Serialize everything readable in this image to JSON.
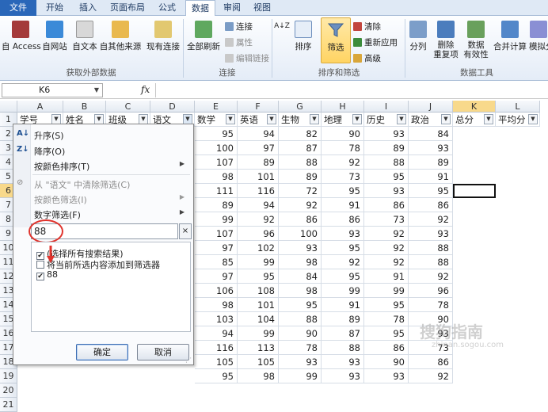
{
  "ribbon_tabs": [
    "文件",
    "开始",
    "插入",
    "页面布局",
    "公式",
    "数据",
    "审阅",
    "视图"
  ],
  "ribbon": {
    "external": {
      "access": "自 Access",
      "web": "自网站",
      "text": "自文本",
      "other": "自其他来源",
      "existing": "现有连接",
      "group": "获取外部数据"
    },
    "connections": {
      "refresh_all": "全部刷新",
      "connections": "连接",
      "properties": "属性",
      "edit_links": "编辑链接",
      "group": "连接"
    },
    "sort_filter": {
      "sort": "排序",
      "filter": "筛选",
      "clear": "清除",
      "reapply": "重新应用",
      "advanced": "高级",
      "group": "排序和筛选"
    },
    "data_tools": {
      "text_to_columns": "分列",
      "remove_dup_1": "删除",
      "remove_dup_2": "重复项",
      "validation_1": "数据",
      "validation_2": "有效性",
      "consolidate": "合并计算",
      "whatif": "模拟分",
      "group": "数据工具"
    }
  },
  "formula_bar": {
    "name_box": "K6",
    "fx": "fx",
    "formula": ""
  },
  "columns": [
    "A",
    "B",
    "C",
    "D",
    "E",
    "F",
    "G",
    "H",
    "I",
    "J",
    "K",
    "L"
  ],
  "headers": [
    "学号",
    "姓名",
    "班级",
    "语文",
    "数学",
    "英语",
    "生物",
    "地理",
    "历史",
    "政治",
    "总分",
    "平均分"
  ],
  "rows": [
    [
      "95",
      "94",
      "82",
      "90",
      "93",
      "84"
    ],
    [
      "100",
      "97",
      "87",
      "78",
      "89",
      "93"
    ],
    [
      "107",
      "89",
      "88",
      "92",
      "88",
      "89"
    ],
    [
      "98",
      "101",
      "89",
      "73",
      "95",
      "91"
    ],
    [
      "111",
      "116",
      "72",
      "95",
      "93",
      "95"
    ],
    [
      "89",
      "94",
      "92",
      "91",
      "86",
      "86"
    ],
    [
      "99",
      "92",
      "86",
      "86",
      "73",
      "92"
    ],
    [
      "107",
      "96",
      "100",
      "93",
      "92",
      "93"
    ],
    [
      "97",
      "102",
      "93",
      "95",
      "92",
      "88"
    ],
    [
      "85",
      "99",
      "98",
      "92",
      "92",
      "88"
    ],
    [
      "97",
      "95",
      "84",
      "95",
      "91",
      "92"
    ],
    [
      "106",
      "108",
      "98",
      "99",
      "99",
      "96"
    ],
    [
      "98",
      "101",
      "95",
      "91",
      "95",
      "78"
    ],
    [
      "103",
      "104",
      "88",
      "89",
      "78",
      "90"
    ],
    [
      "94",
      "99",
      "90",
      "87",
      "95",
      "93"
    ],
    [
      "116",
      "113",
      "78",
      "88",
      "86",
      "73"
    ],
    [
      "105",
      "105",
      "93",
      "93",
      "90",
      "86"
    ],
    [
      "95",
      "98",
      "99",
      "93",
      "93",
      "92"
    ]
  ],
  "row_numbers": [
    "1",
    "2",
    "3",
    "4",
    "5",
    "6",
    "7",
    "8",
    "9",
    "10",
    "11",
    "12",
    "13",
    "14",
    "15",
    "16",
    "17",
    "18",
    "19",
    "20",
    "21"
  ],
  "filter_menu": {
    "sort_asc": "升序(S)",
    "sort_desc": "降序(O)",
    "sort_by_color": "按颜色排序(T)",
    "clear_filter": "从 \"语文\" 中清除筛选(C)",
    "filter_by_color": "按颜色筛选(I)",
    "number_filters": "数字筛选(F)",
    "search_value": "88",
    "search_clear": "×",
    "items": [
      "(选择所有搜索结果)",
      "将当前所选内容添加到筛选器",
      "88"
    ],
    "ok": "确定",
    "cancel": "取消"
  },
  "watermark": "搜狗指南",
  "watermark_url": "zhinan.sogou.com",
  "colors": {
    "accent": "#2a67b9",
    "selection": "#f8d98b",
    "highlight": "#e0332c"
  }
}
